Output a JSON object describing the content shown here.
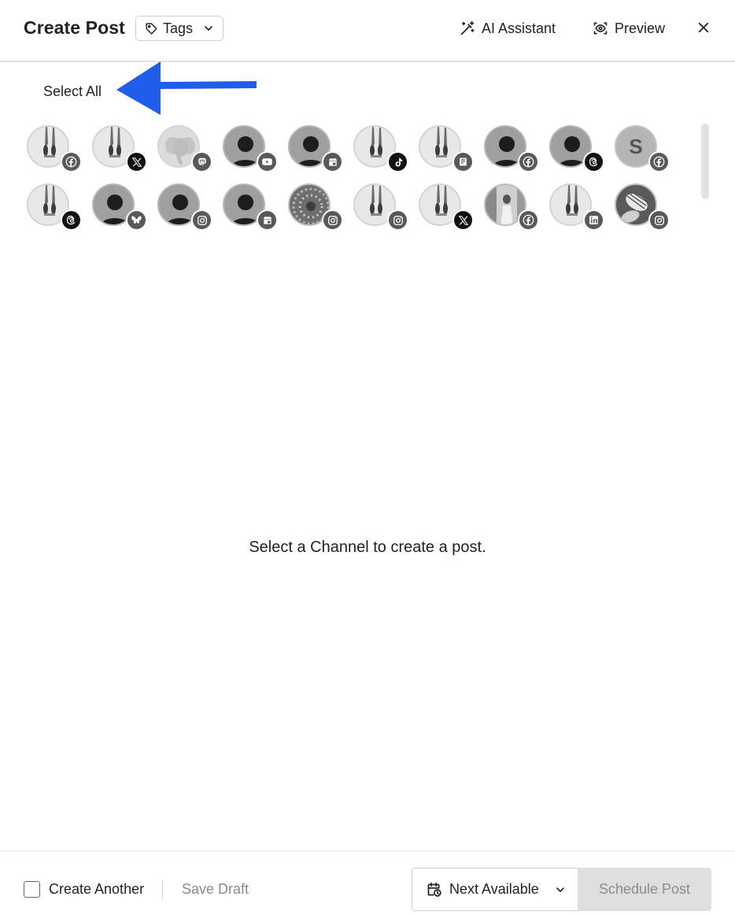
{
  "header": {
    "title": "Create Post",
    "tags_label": "Tags",
    "ai_label": "AI Assistant",
    "preview_label": "Preview"
  },
  "select_all_label": "Select All",
  "annotation_arrow_color": "#1E5EEA",
  "channels": [
    {
      "avatar": "dancer-photo",
      "network": "facebook"
    },
    {
      "avatar": "dancer-photo",
      "network": "x"
    },
    {
      "avatar": "elephant-logo",
      "network": "mastodon"
    },
    {
      "avatar": "default-user",
      "network": "youtube"
    },
    {
      "avatar": "default-user",
      "network": "google-business"
    },
    {
      "avatar": "dancer-photo",
      "network": "tiktok"
    },
    {
      "avatar": "dancer-photo",
      "network": "substack"
    },
    {
      "avatar": "default-user",
      "network": "facebook"
    },
    {
      "avatar": "default-user",
      "network": "threads"
    },
    {
      "avatar": "letter",
      "letter": "S",
      "network": "facebook"
    },
    {
      "avatar": "dancer-photo",
      "network": "threads"
    },
    {
      "avatar": "default-user",
      "network": "bluesky"
    },
    {
      "avatar": "default-user",
      "network": "instagram"
    },
    {
      "avatar": "default-user",
      "network": "google-business"
    },
    {
      "avatar": "abstract-photo",
      "network": "instagram"
    },
    {
      "avatar": "dancer-photo",
      "network": "instagram"
    },
    {
      "avatar": "dancer-photo",
      "network": "x"
    },
    {
      "avatar": "street-photo",
      "network": "facebook"
    },
    {
      "avatar": "dancer-photo",
      "network": "linkedin"
    },
    {
      "avatar": "shoes-photo",
      "network": "instagram"
    }
  ],
  "empty_message": "Select a Channel to create a post.",
  "footer": {
    "create_another_label": "Create Another",
    "save_draft_label": "Save Draft",
    "next_available_label": "Next Available",
    "schedule_label": "Schedule Post"
  }
}
